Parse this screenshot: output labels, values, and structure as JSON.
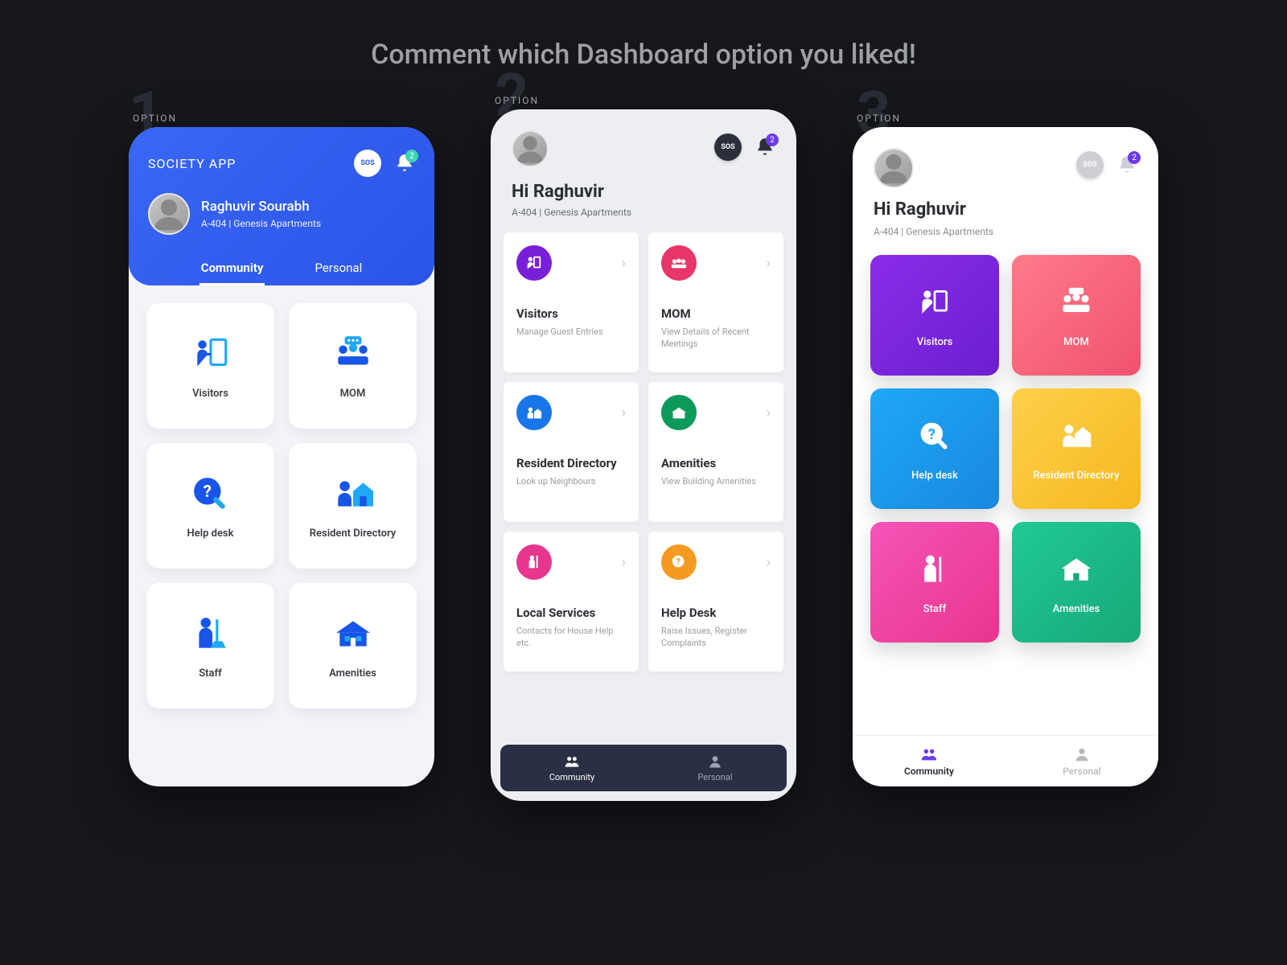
{
  "page_title": "Comment which Dashboard option you liked!",
  "options": {
    "1": "OPTION",
    "2": "OPTION",
    "3": "OPTION"
  },
  "app_name": "SOCIETY APP",
  "badge_count": "2",
  "user": {
    "full_name": "Raghuvir Sourabh",
    "address": "A-404 | Genesis Apartments",
    "greeting": "Hi Raghuvir"
  },
  "tabs": {
    "community": "Community",
    "personal": "Personal"
  },
  "option1_cards": [
    {
      "label": "Visitors"
    },
    {
      "label": "MOM"
    },
    {
      "label": "Help desk"
    },
    {
      "label": "Resident Directory"
    },
    {
      "label": "Staff"
    },
    {
      "label": "Amenities"
    }
  ],
  "option2_cards": [
    {
      "title": "Visitors",
      "sub": "Manage Guest Entries",
      "color": "c-purple"
    },
    {
      "title": "MOM",
      "sub": "View Details of Recent Meetings",
      "color": "c-pinkred"
    },
    {
      "title": "Resident Directory",
      "sub": "Look up Neighbours",
      "color": "c-blue"
    },
    {
      "title": "Amenities",
      "sub": "View Building Amenities",
      "color": "c-green"
    },
    {
      "title": "Local Services",
      "sub": "Contacts for House Help etc.",
      "color": "c-fuchsia"
    },
    {
      "title": "Help Desk",
      "sub": "Raise Issues, Register Complaints",
      "color": "c-orange"
    }
  ],
  "option3_cards": [
    {
      "label": "Visitors",
      "color": "g-purple"
    },
    {
      "label": "MOM",
      "color": "g-pink"
    },
    {
      "label": "Help desk",
      "color": "g-blue"
    },
    {
      "label": "Resident Directory",
      "color": "g-yellow"
    },
    {
      "label": "Staff",
      "color": "g-fuchsia"
    },
    {
      "label": "Amenities",
      "color": "g-green"
    }
  ],
  "sos_label": "SOS"
}
